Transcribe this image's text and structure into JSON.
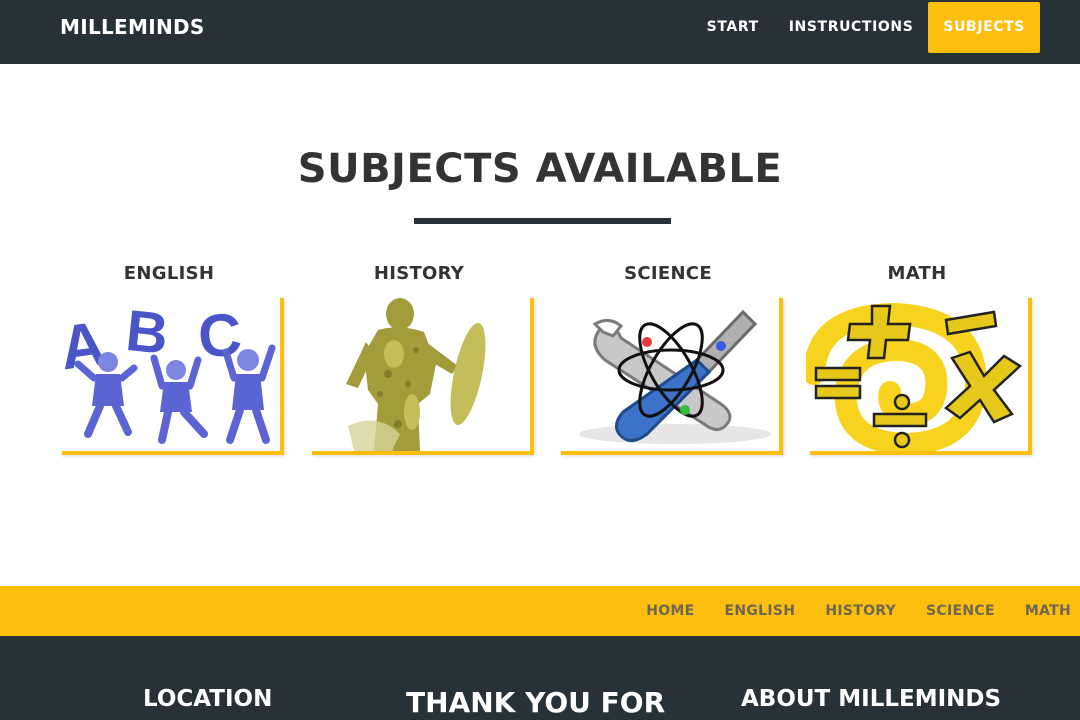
{
  "navbar": {
    "brand": "MILLEMINDS",
    "links": [
      {
        "label": "START",
        "active": false
      },
      {
        "label": "INSTRUCTIONS",
        "active": false
      },
      {
        "label": "SUBJECTS",
        "active": true
      }
    ]
  },
  "main": {
    "title": "SUBJECTS AVAILABLE",
    "subjects": [
      {
        "label": "ENGLISH",
        "image": "abc-kids-icon"
      },
      {
        "label": "HISTORY",
        "image": "statue-icon"
      },
      {
        "label": "SCIENCE",
        "image": "atom-tools-icon"
      },
      {
        "label": "MATH",
        "image": "math-symbols-icon"
      }
    ]
  },
  "subnav": {
    "links": [
      "HOME",
      "ENGLISH",
      "HISTORY",
      "SCIENCE",
      "MATH"
    ]
  },
  "footer": {
    "headings": [
      "LOCATION",
      "THANK YOU FOR",
      "ABOUT MILLEMINDS"
    ]
  },
  "colors": {
    "dark": "#263238",
    "accent": "#fcbf10"
  }
}
